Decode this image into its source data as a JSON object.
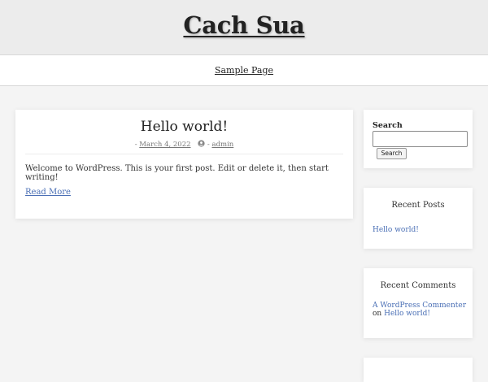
{
  "header": {
    "site_title": "Cach Sua"
  },
  "nav": {
    "items": [
      {
        "label": "Sample Page"
      }
    ]
  },
  "post": {
    "title": "Hello world!",
    "date_prefix": "-",
    "date": "March 4, 2022",
    "author_prefix": "-",
    "author": "admin",
    "excerpt": "Welcome to WordPress. This is your first post. Edit or delete it, then start writing!",
    "read_more": "Read More",
    "author_icon": "user-circle-icon"
  },
  "sidebar": {
    "search": {
      "heading": "Search",
      "input_value": "",
      "button_label": "Search"
    },
    "recent_posts": {
      "heading": "Recent Posts",
      "items": [
        {
          "label": "Hello world!"
        }
      ]
    },
    "recent_comments": {
      "heading": "Recent Comments",
      "items": [
        {
          "author": "A WordPress Commenter",
          "on_text": "on",
          "post": "Hello world!"
        }
      ]
    }
  },
  "colors": {
    "link": "#4a6fb5",
    "header_bg": "#ececec",
    "page_bg": "#f4f4f4"
  }
}
